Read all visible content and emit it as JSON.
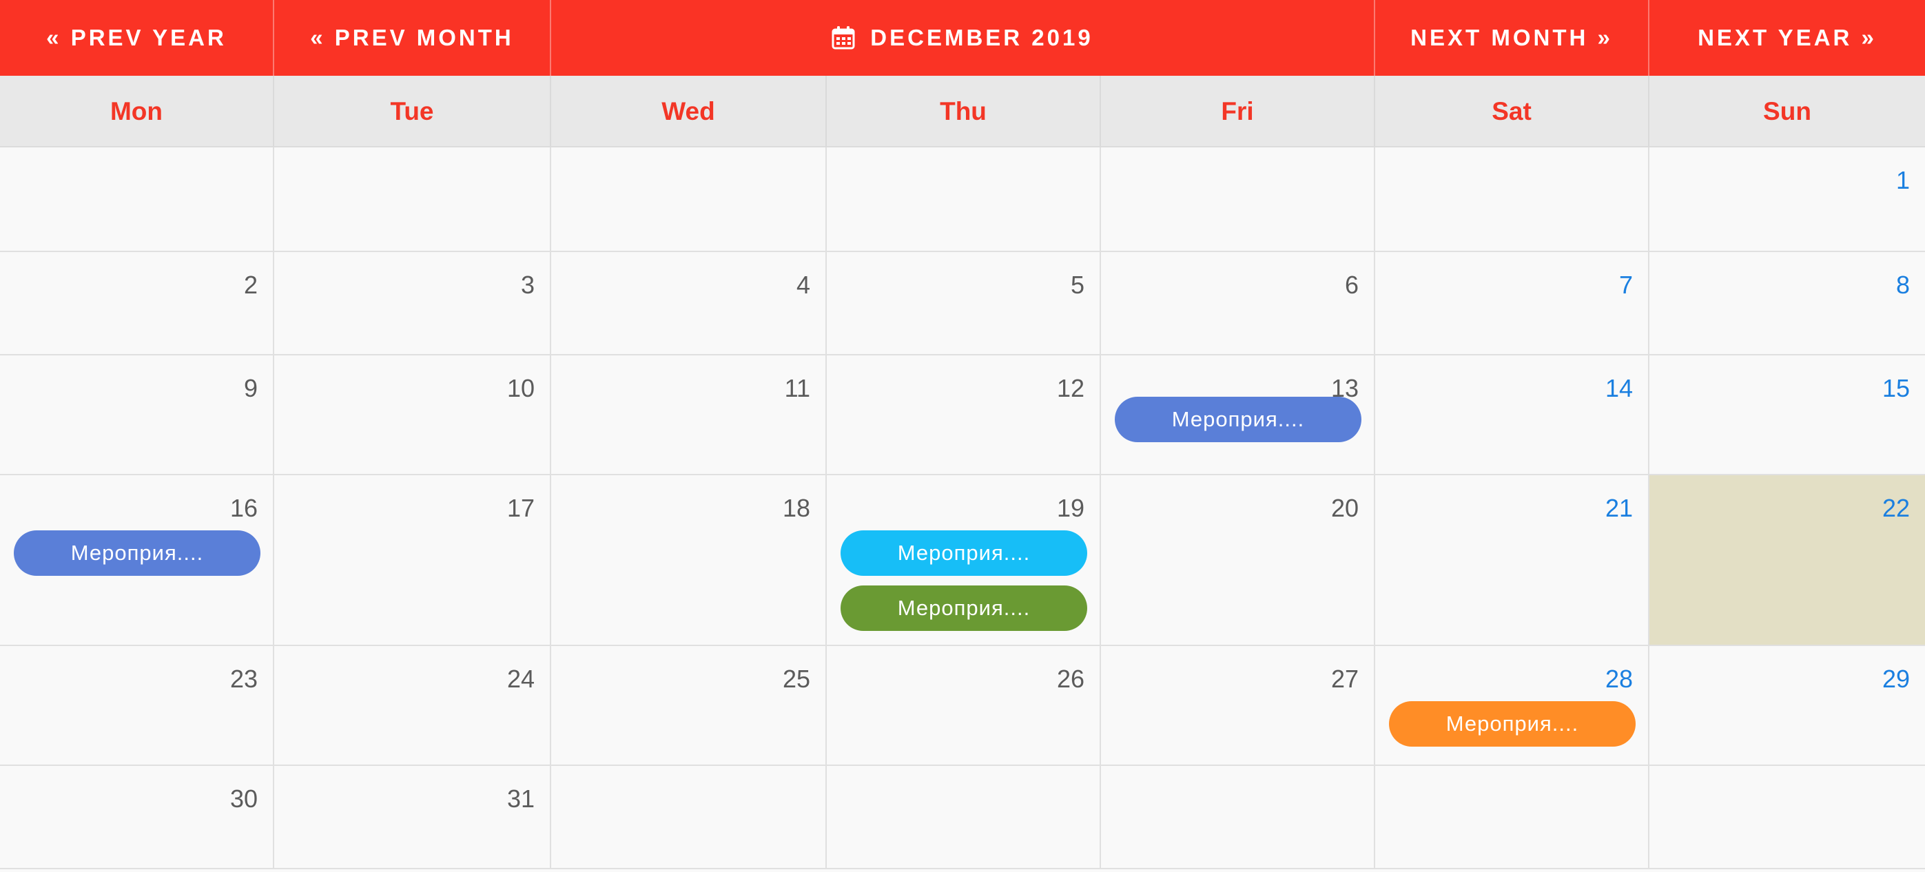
{
  "nav": {
    "prev_year": "« PREV YEAR",
    "prev_month": "« PREV MONTH",
    "title": "DECEMBER 2019",
    "title_icon": "calendar-icon",
    "next_month": "NEXT MONTH »",
    "next_year": "NEXT YEAR »"
  },
  "colors": {
    "accent": "#fa3325",
    "weekend_number": "#1a7fe0",
    "weekday_number": "#5b5b5b",
    "today_bg": "#e3dfc5",
    "event_blue": "#5a7fd8",
    "event_cyan": "#17bef7",
    "event_green": "#6a9a33",
    "event_orange": "#ff8d26"
  },
  "weekdays": [
    "Mon",
    "Tue",
    "Wed",
    "Thu",
    "Fri",
    "Sat",
    "Sun"
  ],
  "today": "22",
  "weeks": [
    [
      "",
      "",
      "",
      "",
      "",
      "",
      "1"
    ],
    [
      "2",
      "3",
      "4",
      "5",
      "6",
      "7",
      "8"
    ],
    [
      "9",
      "10",
      "11",
      "12",
      "13",
      "14",
      "15"
    ],
    [
      "16",
      "17",
      "18",
      "19",
      "20",
      "21",
      "22"
    ],
    [
      "23",
      "24",
      "25",
      "26",
      "27",
      "28",
      "29"
    ],
    [
      "30",
      "31",
      "",
      "",
      "",
      "",
      ""
    ]
  ],
  "events": [
    {
      "day": "13",
      "label": "Мероприя....",
      "color": "#5a7fd8"
    },
    {
      "day": "16",
      "label": "Мероприя....",
      "color": "#5a7fd8"
    },
    {
      "day": "19",
      "label": "Мероприя....",
      "color": "#17bef7"
    },
    {
      "day": "19",
      "label": "Мероприя....",
      "color": "#6a9a33"
    },
    {
      "day": "28",
      "label": "Мероприя....",
      "color": "#ff8d26"
    }
  ]
}
